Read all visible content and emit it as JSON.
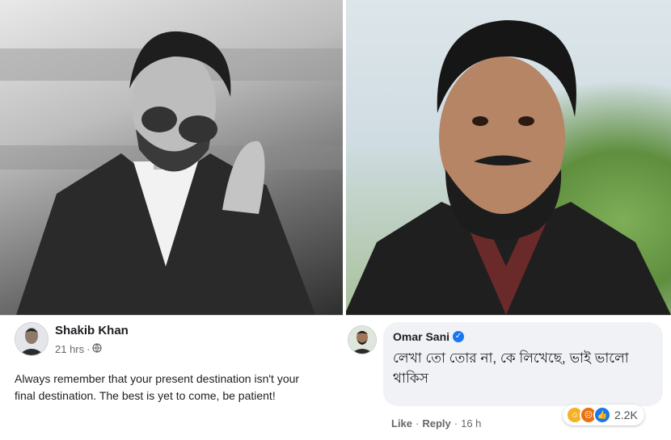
{
  "post": {
    "author": "Shakib Khan",
    "time": "21 hrs",
    "separator": "·",
    "text": "Always remember that your present destination isn't your final destination. The best is yet to come, be patient!"
  },
  "comment": {
    "author": "Omar Sani",
    "text": "লেখা তো তোর না, কে লিখেছে, ভাই ভালো থাকিস",
    "reaction_count": "2.2K",
    "actions": {
      "like": "Like",
      "sep1": "·",
      "reply": "Reply",
      "sep2": "·",
      "time": "16 h"
    }
  },
  "colors": {
    "facebook_blue": "#1877f2",
    "haha_yellow": "#f7b125",
    "angry_red": "#e9710f"
  },
  "icons": [
    "globe-icon",
    "verified-badge-icon",
    "haha-reaction-icon",
    "angry-reaction-icon",
    "like-reaction-icon"
  ]
}
